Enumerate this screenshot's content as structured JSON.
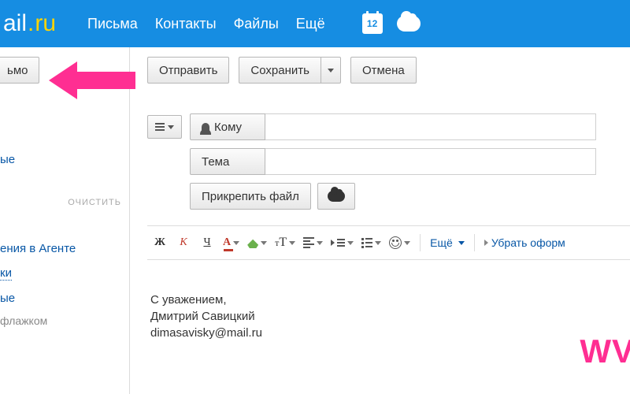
{
  "header": {
    "logo_left": "ail",
    "logo_right": "ru",
    "nav": {
      "mail": "Письма",
      "contacts": "Контакты",
      "files": "Файлы",
      "more": "Ещё"
    },
    "calendar_day": "12"
  },
  "sidebar": {
    "compose": "ьмо",
    "link1": "ые",
    "clear": "очистить",
    "link_agent": "ения в Агенте",
    "link_dotted": "ки",
    "link_plain": "ые",
    "flag_text": "флажком"
  },
  "actions": {
    "send": "Отправить",
    "save": "Сохранить",
    "cancel": "Отмена"
  },
  "compose": {
    "to_label": "Кому",
    "subject_label": "Тема",
    "attach": "Прикрепить файл"
  },
  "toolbar": {
    "bold": "Ж",
    "italic": "К",
    "under": "Ч",
    "fcolor": "А",
    "size_small": "т",
    "size_big": "Т",
    "more": "Ещё",
    "remove_format": "Убрать оформ"
  },
  "signature": {
    "line1": "С уважением,",
    "line2": "Дмитрий Савицкий",
    "line3": "dimasavisky@mail.ru"
  },
  "watermark": "WV"
}
